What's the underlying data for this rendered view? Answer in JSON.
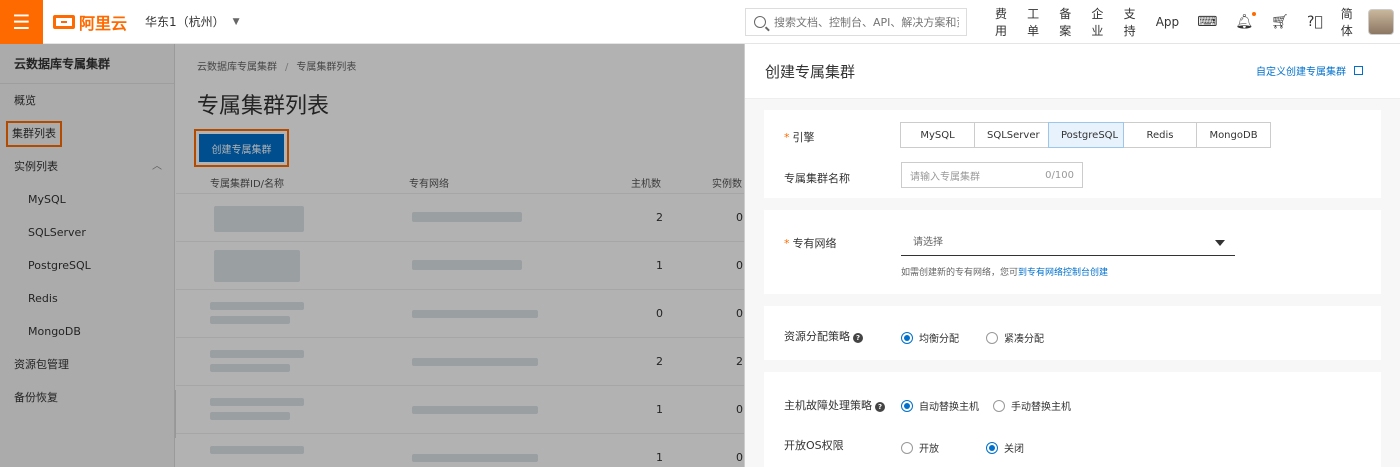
{
  "topbar": {
    "menu_icon": "menu-icon",
    "brand": "阿里云",
    "region": "华东1（杭州）",
    "search_placeholder": "搜索文档、控制台、API、解决方案和资",
    "nav": [
      "费用",
      "工单",
      "备案",
      "企业",
      "支持",
      "App"
    ],
    "lang": "简体",
    "accent": "#ff6a00"
  },
  "sidebar": {
    "title": "云数据库专属集群",
    "items": [
      {
        "label": "概览"
      },
      {
        "label": "集群列表"
      },
      {
        "label": "实例列表"
      },
      {
        "label": "MySQL"
      },
      {
        "label": "SQLServer"
      },
      {
        "label": "PostgreSQL"
      },
      {
        "label": "Redis"
      },
      {
        "label": "MongoDB"
      },
      {
        "label": "资源包管理"
      },
      {
        "label": "备份恢复"
      }
    ]
  },
  "main": {
    "breadcrumb": [
      "云数据库专属集群",
      "专属集群列表"
    ],
    "title": "专属集群列表",
    "create_button": "创建专属集群",
    "columns": [
      "专属集群ID/名称",
      "专有网络",
      "主机数",
      "实例数"
    ],
    "rows": [
      {
        "hosts": "2",
        "instances": "0"
      },
      {
        "hosts": "1",
        "instances": "0"
      },
      {
        "hosts": "0",
        "instances": "0"
      },
      {
        "hosts": "2",
        "instances": "2"
      },
      {
        "hosts": "1",
        "instances": "0"
      },
      {
        "hosts": "1",
        "instances": "0"
      }
    ]
  },
  "drawer": {
    "title": "创建专属集群",
    "custom_link": "自定义创建专属集群",
    "engine_label": "引擎",
    "engines": [
      "MySQL",
      "SQLServer",
      "PostgreSQL",
      "Redis",
      "MongoDB"
    ],
    "selected_engine": "PostgreSQL",
    "name_label": "专属集群名称",
    "name_placeholder": "请输入专属集群",
    "name_count": "0/100",
    "vpc_label": "专有网络",
    "vpc_placeholder": "请选择",
    "vpc_hint": "如需创建新的专有网络，您可",
    "vpc_hint_link": "到专有网络控制台创建",
    "alloc_label": "资源分配策略",
    "alloc_options": [
      "均衡分配",
      "紧凑分配"
    ],
    "alloc_selected": "均衡分配",
    "failover_label": "主机故障处理策略",
    "failover_options": [
      "自动替换主机",
      "手动替换主机"
    ],
    "failover_selected": "自动替换主机",
    "os_label": "开放OS权限",
    "os_options": [
      "开放",
      "关闭"
    ],
    "os_selected": "关闭"
  }
}
